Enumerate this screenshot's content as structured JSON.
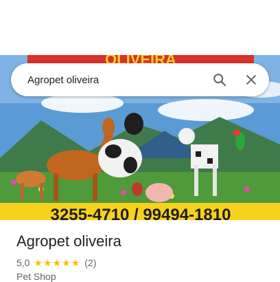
{
  "search": {
    "query": "Agropet oliveira"
  },
  "place": {
    "name": "Agropet oliveira",
    "rating": "5,0",
    "stars": 5,
    "review_count": "(2)",
    "category": "Pet Shop"
  },
  "photo": {
    "banner_text_top": "OLIVEIRA",
    "banner_text_bottom": "3255-4710 / 99494-1810"
  },
  "icons": {
    "search": "search-icon",
    "close": "close-icon",
    "star": "star-icon"
  },
  "colors": {
    "star": "#fbbc04",
    "text_primary": "#202124",
    "text_secondary": "#5f6368"
  }
}
